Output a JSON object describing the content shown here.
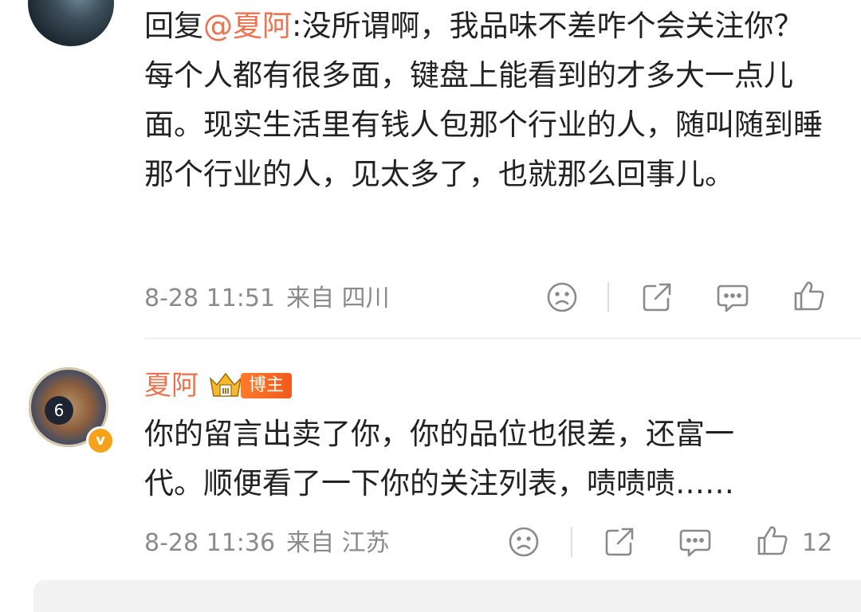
{
  "comments": [
    {
      "reply_prefix": "回复",
      "mention": "@夏阿",
      "text": ":没所谓啊，我品味不差咋个会关注你？每个人都有很多面，键盘上能看到的才多大一点儿面。现实生活里有钱人包那个行业的人，随叫随到睡那个行业的人，见太多了，也就那么回事儿。",
      "time": "8-28 11:51",
      "location": "来自 四川",
      "like_count": ""
    },
    {
      "username": "夏阿",
      "badge_label": "博主",
      "avatar_number": "6",
      "verified_mark": "v",
      "text": "你的留言出卖了你，你的品位也很差，还富一代。顺便看了一下你的关注列表，啧啧啧……",
      "time": "8-28 11:36",
      "location": "来自 江苏",
      "like_count": "12"
    }
  ],
  "icons": {
    "dislike": "sad-face-icon",
    "share": "share-icon",
    "comment": "comment-icon",
    "like": "thumbs-up-icon"
  },
  "colors": {
    "mention": "#eb7350",
    "username": "#eb7350",
    "meta": "#8a8a8a",
    "badge": "#f25a1b",
    "verified": "#f7a21b"
  }
}
